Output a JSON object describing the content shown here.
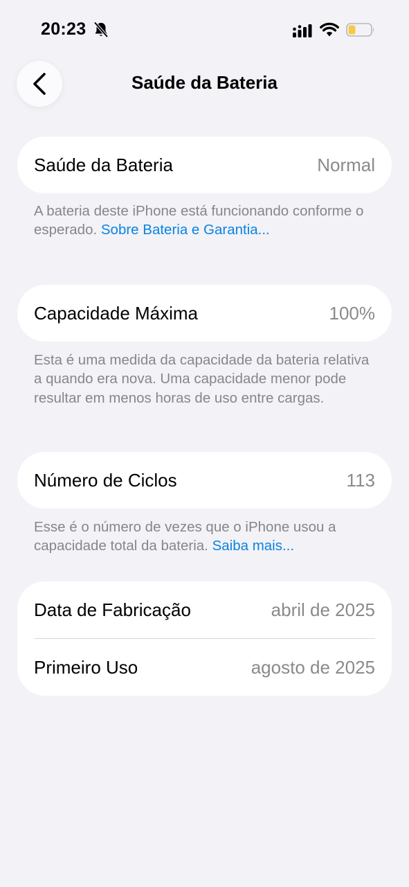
{
  "status_bar": {
    "time": "20:23"
  },
  "nav": {
    "title": "Saúde da Bateria"
  },
  "sections": [
    {
      "rows": [
        {
          "label": "Saúde da Bateria",
          "value": "Normal"
        }
      ],
      "footnote": {
        "text": "A bateria deste iPhone está funcionando conforme o esperado. ",
        "link": "Sobre Bateria e Garantia..."
      }
    },
    {
      "rows": [
        {
          "label": "Capacidade Máxima",
          "value": "100%"
        }
      ],
      "footnote": {
        "text": "Esta é uma medida da capacidade da bateria relativa a quando era nova. Uma capacidade menor pode resultar em menos horas de uso entre cargas.",
        "link": ""
      }
    },
    {
      "rows": [
        {
          "label": "Número de Ciclos",
          "value": "113"
        }
      ],
      "footnote": {
        "text": "Esse é o número de vezes que o iPhone usou a capacidade total da bateria. ",
        "link": "Saiba mais..."
      }
    },
    {
      "rows": [
        {
          "label": "Data de Fabricação",
          "value": "abril de 2025"
        },
        {
          "label": "Primeiro Uso",
          "value": "agosto de 2025"
        }
      ]
    }
  ],
  "colors": {
    "background": "#f2f2f7",
    "link": "#0a84e0",
    "secondary_text": "#8a8a8e",
    "battery_level": "#f7c948"
  },
  "icons": {
    "bell": "bell-slash-icon",
    "signal": "cellular-signal-icon",
    "wifi": "wifi-icon",
    "battery": "battery-icon",
    "back": "chevron-left-icon"
  }
}
